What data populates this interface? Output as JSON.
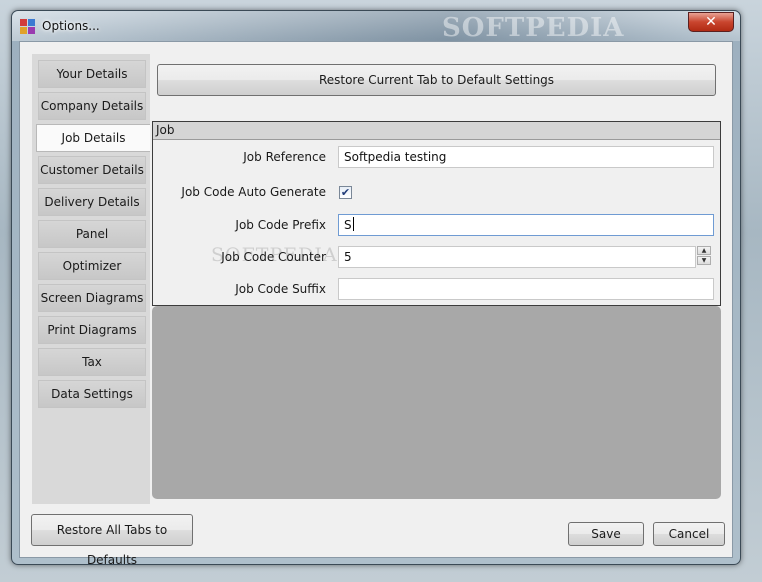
{
  "window": {
    "title": "Options...",
    "watermark": "SOFTPEDIA",
    "close_icon": "✕"
  },
  "tabs": [
    {
      "label": "Your Details",
      "active": false
    },
    {
      "label": "Company Details",
      "active": false
    },
    {
      "label": "Job Details",
      "active": true
    },
    {
      "label": "Customer Details",
      "active": false
    },
    {
      "label": "Delivery Details",
      "active": false
    },
    {
      "label": "Panel",
      "active": false
    },
    {
      "label": "Optimizer",
      "active": false
    },
    {
      "label": "Screen Diagrams",
      "active": false
    },
    {
      "label": "Print Diagrams",
      "active": false
    },
    {
      "label": "Tax",
      "active": false
    },
    {
      "label": "Data Settings",
      "active": false
    }
  ],
  "restore_tab_button": "Restore Current Tab to Default Settings",
  "group": {
    "title": "Job",
    "job_reference_label": "Job Reference",
    "job_reference_value": "Softpedia testing",
    "auto_generate_label": "Job Code Auto Generate",
    "auto_generate_checked": true,
    "check_mark": "✔",
    "prefix_label": "Job Code Prefix",
    "prefix_value": "S",
    "counter_label": "Job Code Counter",
    "counter_value": "5",
    "spin_up": "▲",
    "spin_down": "▼",
    "suffix_label": "Job Code Suffix",
    "suffix_value": ""
  },
  "footer": {
    "restore_all_button": "Restore All Tabs to Defaults",
    "save_button": "Save",
    "cancel_button": "Cancel"
  },
  "colors": {
    "panel_gray": "#a8a8a8",
    "close_red": "#c9452e",
    "tab_active": "#fafafa"
  }
}
